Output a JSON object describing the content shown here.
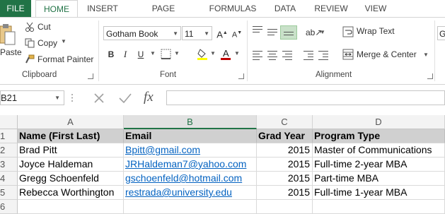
{
  "ribbon": {
    "tabs": [
      "FILE",
      "HOME",
      "INSERT",
      "PAGE LAYOUT",
      "FORMULAS",
      "DATA",
      "REVIEW",
      "VIEW"
    ],
    "clipboard": {
      "paste": "Paste",
      "cut": "Cut",
      "copy": "Copy",
      "format_painter": "Format Painter",
      "label": "Clipboard"
    },
    "font": {
      "name": "Gotham Book",
      "size": "11",
      "label": "Font",
      "bold": "B",
      "italic": "I",
      "underline": "U",
      "grow": "A",
      "shrink": "A"
    },
    "alignment": {
      "wrap_text": "Wrap Text",
      "merge_center": "Merge & Center",
      "label": "Alignment"
    },
    "number": {
      "format": "G"
    }
  },
  "formula_bar": {
    "name_box": "B21",
    "fx": "fx",
    "formula": ""
  },
  "columns": [
    "A",
    "B",
    "C",
    "D"
  ],
  "rows": [
    "1",
    "2",
    "3",
    "4",
    "5",
    "6"
  ],
  "sheet": {
    "header": [
      "Name (First Last)",
      "Email",
      "Grad Year",
      "Program Type"
    ],
    "records": [
      [
        "Brad Pitt",
        "Bpitt@gmail.com",
        "2015",
        "Master of Communications"
      ],
      [
        "Joyce Haldeman",
        "JRHaldeman7@yahoo.com",
        "2015",
        "Full-time 2-year MBA"
      ],
      [
        "Gregg Schoenfeld",
        "gschoenfeld@hotmail.com",
        "2015",
        "Part-time MBA"
      ],
      [
        "Rebecca Worthington",
        "restrada@university.edu",
        "2015",
        "Full-time 1-year MBA"
      ]
    ]
  },
  "colors": {
    "file_tab": "#217346",
    "accent": "#217346",
    "link": "#0563c1",
    "header_fill": "#d0d0d0"
  }
}
